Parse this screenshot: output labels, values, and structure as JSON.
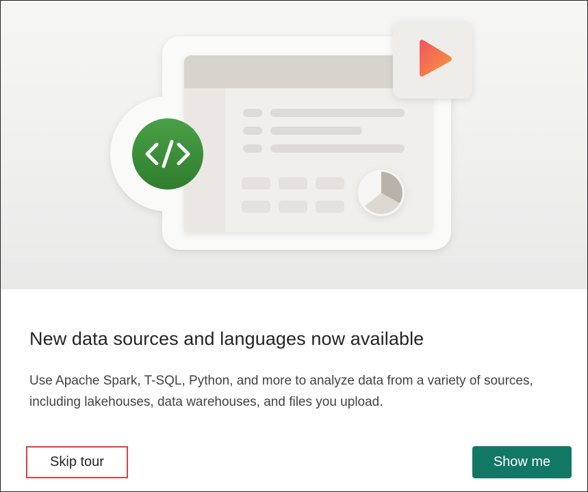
{
  "dialog": {
    "title": "New data sources and languages now available",
    "description": "Use Apache Spark, T-SQL, Python, and more to analyze data from a variety of sources, including lakehouses, data warehouses, and files you upload.",
    "skip_label": "Skip tour",
    "primary_label": "Show me"
  },
  "illustration": {
    "icons": [
      "code-icon",
      "play-icon",
      "pie-chart-icon"
    ],
    "colors": {
      "code_badge": "#3c8c3a",
      "play_start": "#f2525f",
      "play_end": "#f79b3c",
      "primary_button": "#117865",
      "highlight_border": "#e0403a"
    }
  }
}
